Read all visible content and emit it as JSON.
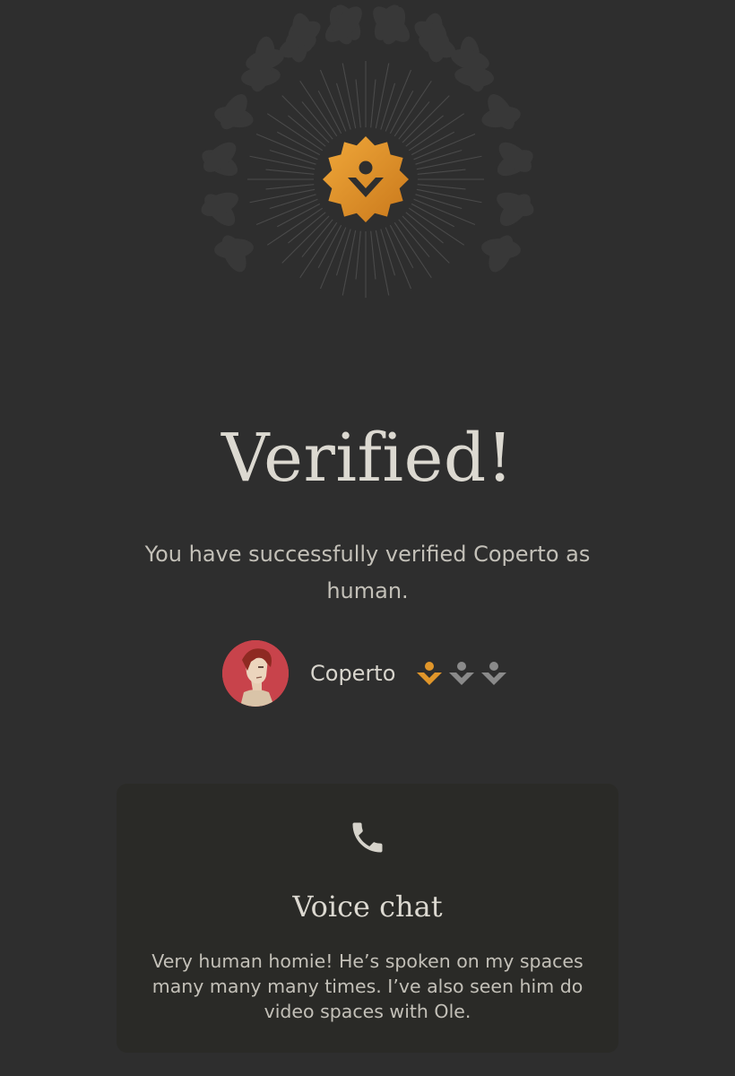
{
  "theme": {
    "background": "#2e2e2e",
    "accent_gold": "#e0962a",
    "badge_inactive": "#8a8a8a",
    "laurel": "#383838",
    "avatar_bg": "#c8434b"
  },
  "hero": {
    "icons": [
      "laurel-wreath-icon",
      "sunburst-rays",
      "verified-seal-icon"
    ]
  },
  "status": {
    "title": "Verified!",
    "message": "You have successfully verified Coperto as human."
  },
  "user": {
    "name": "Coperto",
    "avatar": "illustrated-avatar",
    "verification_level": 1,
    "verification_max": 3
  },
  "proof_card": {
    "icon": "phone-icon",
    "title": "Voice chat",
    "body": "Very human homie! He’s spoken on my spaces many many many times. I’ve also seen him do video spaces with Ole."
  }
}
